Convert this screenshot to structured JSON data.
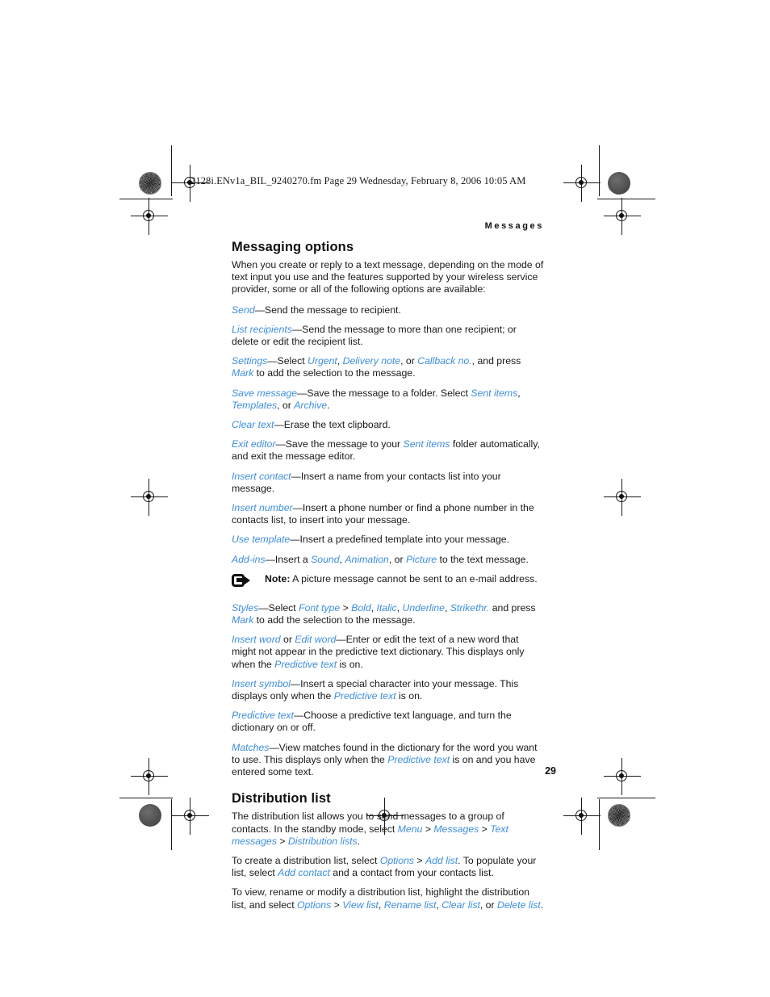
{
  "print_header": {
    "file_line": "2128i.ENv1a_BIL_9240270.fm  Page 29  Wednesday, February 8, 2006  10:05 AM"
  },
  "running_head": "Messages",
  "page_number": "29",
  "colors": {
    "ui_term": "#3d8ede",
    "text": "#1a1a1a",
    "page_bg": "#ffffff"
  },
  "sections": [
    {
      "heading": "Messaging options",
      "intro": "When you create or reply to a text message, depending on the mode of text input you use and the features supported by your wireless service provider, some or all of the following options are available:"
    },
    {
      "heading": "Distribution list",
      "intro": "The distribution list allows you to send messages to a group of contacts. In the standby mode, select "
    }
  ],
  "options": {
    "send": {
      "term": "Send",
      "desc": "—Send the message to recipient."
    },
    "list_recipients": {
      "term": "List recipients",
      "desc": "—Send the message to more than one recipient; or delete or edit the recipient list."
    },
    "settings": {
      "term": "Settings",
      "t1": "—Select ",
      "urgent": "Urgent",
      "t2": ", ",
      "delivery_note": "Delivery note",
      "t3": ", or ",
      "callback_no": "Callback no.",
      "t4": ", and press ",
      "mark": "Mark",
      "t5": " to add the selection to the message."
    },
    "save_message": {
      "term": "Save message",
      "t1": "—Save the message to a folder. Select ",
      "sent_items": "Sent items",
      "t2": ", ",
      "templates": "Templates",
      "t3": ", or ",
      "archive": "Archive",
      "t4": "."
    },
    "clear_text": {
      "term": "Clear text",
      "desc": "—Erase the text clipboard."
    },
    "exit_editor": {
      "term": "Exit editor",
      "t1": "—Save the message to your ",
      "sent_items": "Sent items",
      "t2": " folder automatically, and exit the message editor."
    },
    "insert_contact": {
      "term": "Insert contact",
      "desc": "—Insert a name from your contacts list into your message."
    },
    "insert_number": {
      "term": "Insert number",
      "desc": "—Insert a phone number or find a phone number in the contacts list, to insert into your message."
    },
    "use_template": {
      "term": "Use template",
      "desc": "—Insert a predefined template into your message."
    },
    "add_ins": {
      "term": "Add-ins",
      "t1": "—Insert a ",
      "sound": "Sound",
      "t2": ", ",
      "animation": "Animation",
      "t3": ", or ",
      "picture": "Picture",
      "t4": " to the text message."
    },
    "styles": {
      "term": "Styles",
      "t1": "—Select ",
      "font_type": "Font type",
      "t2": " > ",
      "bold": "Bold",
      "t3": ", ",
      "italic": "Italic",
      "t4": ", ",
      "underline": "Underline",
      "t5": ", ",
      "strikethr": "Strikethr.",
      "t6": " and press ",
      "mark": "Mark",
      "t7": " to add the selection to the message."
    },
    "insert_word": {
      "term": "Insert word",
      "t1": " or ",
      "term2": "Edit word",
      "t2": "—Enter or edit the text of a new word that might not appear in the predictive text dictionary. This displays only when the ",
      "predictive_text": "Predictive text",
      "t3": " is on."
    },
    "insert_symbol": {
      "term": "Insert symbol",
      "t1": "—Insert a special character into your message. This displays only when the ",
      "predictive_text": "Predictive text",
      "t2": " is on."
    },
    "predictive_text": {
      "term": "Predictive text",
      "desc": "—Choose a predictive text language, and turn the dictionary on or off."
    },
    "matches": {
      "term": "Matches",
      "t1": "—View matches found in the dictionary for the word you want to use. This displays only when the ",
      "predictive_text": "Predictive text",
      "t2": " is on and you have entered some text."
    }
  },
  "note": {
    "label": "Note:",
    "text": "A picture message cannot be sent to an e-mail address."
  },
  "distribution_list": {
    "p1": {
      "t1": "The distribution list allows you to send messages to a group of contacts. In the standby mode, select ",
      "menu": "Menu",
      "t2": " > ",
      "messages": "Messages",
      "t3": " > ",
      "text_messages": "Text messages",
      "t4": " > ",
      "distribution_lists": "Distribution lists",
      "t5": "."
    },
    "p2": {
      "t1": "To create a distribution list, select ",
      "options": "Options",
      "t2": " > ",
      "add_list": "Add list",
      "t3": ". To populate your list, select ",
      "add_contact": "Add contact",
      "t4": " and a contact from your contacts list."
    },
    "p3": {
      "t1": "To view, rename or modify a distribution list, highlight the distribution list, and select ",
      "options": "Options",
      "t2": " > ",
      "view_list": "View list",
      "t3": ", ",
      "rename_list": "Rename list",
      "t4": ", ",
      "clear_list": "Clear list",
      "t5": ", or ",
      "delete_list": "Delete list",
      "t6": "."
    }
  }
}
